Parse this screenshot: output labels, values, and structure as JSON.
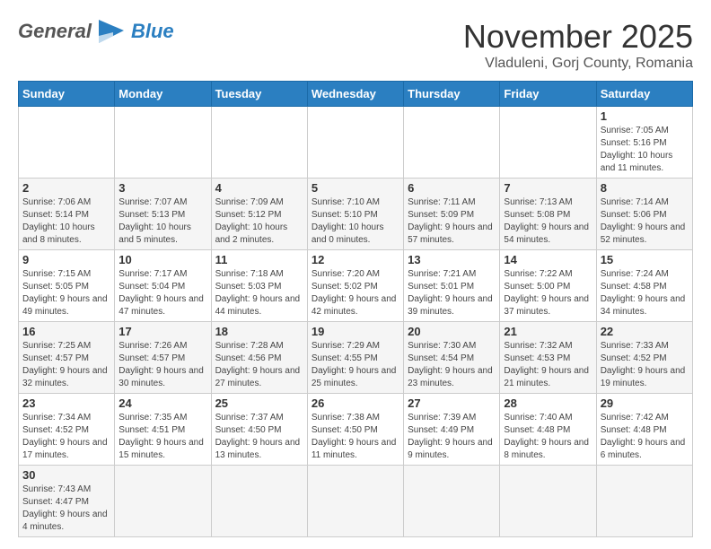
{
  "header": {
    "logo": {
      "general": "General",
      "blue": "Blue"
    },
    "month": "November 2025",
    "location": "Vladuleni, Gorj County, Romania"
  },
  "weekdays": [
    "Sunday",
    "Monday",
    "Tuesday",
    "Wednesday",
    "Thursday",
    "Friday",
    "Saturday"
  ],
  "weeks": [
    [
      {
        "day": "",
        "info": ""
      },
      {
        "day": "",
        "info": ""
      },
      {
        "day": "",
        "info": ""
      },
      {
        "day": "",
        "info": ""
      },
      {
        "day": "",
        "info": ""
      },
      {
        "day": "",
        "info": ""
      },
      {
        "day": "1",
        "info": "Sunrise: 7:05 AM\nSunset: 5:16 PM\nDaylight: 10 hours and 11 minutes."
      }
    ],
    [
      {
        "day": "2",
        "info": "Sunrise: 7:06 AM\nSunset: 5:14 PM\nDaylight: 10 hours and 8 minutes."
      },
      {
        "day": "3",
        "info": "Sunrise: 7:07 AM\nSunset: 5:13 PM\nDaylight: 10 hours and 5 minutes."
      },
      {
        "day": "4",
        "info": "Sunrise: 7:09 AM\nSunset: 5:12 PM\nDaylight: 10 hours and 2 minutes."
      },
      {
        "day": "5",
        "info": "Sunrise: 7:10 AM\nSunset: 5:10 PM\nDaylight: 10 hours and 0 minutes."
      },
      {
        "day": "6",
        "info": "Sunrise: 7:11 AM\nSunset: 5:09 PM\nDaylight: 9 hours and 57 minutes."
      },
      {
        "day": "7",
        "info": "Sunrise: 7:13 AM\nSunset: 5:08 PM\nDaylight: 9 hours and 54 minutes."
      },
      {
        "day": "8",
        "info": "Sunrise: 7:14 AM\nSunset: 5:06 PM\nDaylight: 9 hours and 52 minutes."
      }
    ],
    [
      {
        "day": "9",
        "info": "Sunrise: 7:15 AM\nSunset: 5:05 PM\nDaylight: 9 hours and 49 minutes."
      },
      {
        "day": "10",
        "info": "Sunrise: 7:17 AM\nSunset: 5:04 PM\nDaylight: 9 hours and 47 minutes."
      },
      {
        "day": "11",
        "info": "Sunrise: 7:18 AM\nSunset: 5:03 PM\nDaylight: 9 hours and 44 minutes."
      },
      {
        "day": "12",
        "info": "Sunrise: 7:20 AM\nSunset: 5:02 PM\nDaylight: 9 hours and 42 minutes."
      },
      {
        "day": "13",
        "info": "Sunrise: 7:21 AM\nSunset: 5:01 PM\nDaylight: 9 hours and 39 minutes."
      },
      {
        "day": "14",
        "info": "Sunrise: 7:22 AM\nSunset: 5:00 PM\nDaylight: 9 hours and 37 minutes."
      },
      {
        "day": "15",
        "info": "Sunrise: 7:24 AM\nSunset: 4:58 PM\nDaylight: 9 hours and 34 minutes."
      }
    ],
    [
      {
        "day": "16",
        "info": "Sunrise: 7:25 AM\nSunset: 4:57 PM\nDaylight: 9 hours and 32 minutes."
      },
      {
        "day": "17",
        "info": "Sunrise: 7:26 AM\nSunset: 4:57 PM\nDaylight: 9 hours and 30 minutes."
      },
      {
        "day": "18",
        "info": "Sunrise: 7:28 AM\nSunset: 4:56 PM\nDaylight: 9 hours and 27 minutes."
      },
      {
        "day": "19",
        "info": "Sunrise: 7:29 AM\nSunset: 4:55 PM\nDaylight: 9 hours and 25 minutes."
      },
      {
        "day": "20",
        "info": "Sunrise: 7:30 AM\nSunset: 4:54 PM\nDaylight: 9 hours and 23 minutes."
      },
      {
        "day": "21",
        "info": "Sunrise: 7:32 AM\nSunset: 4:53 PM\nDaylight: 9 hours and 21 minutes."
      },
      {
        "day": "22",
        "info": "Sunrise: 7:33 AM\nSunset: 4:52 PM\nDaylight: 9 hours and 19 minutes."
      }
    ],
    [
      {
        "day": "23",
        "info": "Sunrise: 7:34 AM\nSunset: 4:52 PM\nDaylight: 9 hours and 17 minutes."
      },
      {
        "day": "24",
        "info": "Sunrise: 7:35 AM\nSunset: 4:51 PM\nDaylight: 9 hours and 15 minutes."
      },
      {
        "day": "25",
        "info": "Sunrise: 7:37 AM\nSunset: 4:50 PM\nDaylight: 9 hours and 13 minutes."
      },
      {
        "day": "26",
        "info": "Sunrise: 7:38 AM\nSunset: 4:50 PM\nDaylight: 9 hours and 11 minutes."
      },
      {
        "day": "27",
        "info": "Sunrise: 7:39 AM\nSunset: 4:49 PM\nDaylight: 9 hours and 9 minutes."
      },
      {
        "day": "28",
        "info": "Sunrise: 7:40 AM\nSunset: 4:48 PM\nDaylight: 9 hours and 8 minutes."
      },
      {
        "day": "29",
        "info": "Sunrise: 7:42 AM\nSunset: 4:48 PM\nDaylight: 9 hours and 6 minutes."
      }
    ],
    [
      {
        "day": "30",
        "info": "Sunrise: 7:43 AM\nSunset: 4:47 PM\nDaylight: 9 hours and 4 minutes."
      },
      {
        "day": "",
        "info": ""
      },
      {
        "day": "",
        "info": ""
      },
      {
        "day": "",
        "info": ""
      },
      {
        "day": "",
        "info": ""
      },
      {
        "day": "",
        "info": ""
      },
      {
        "day": "",
        "info": ""
      }
    ]
  ]
}
